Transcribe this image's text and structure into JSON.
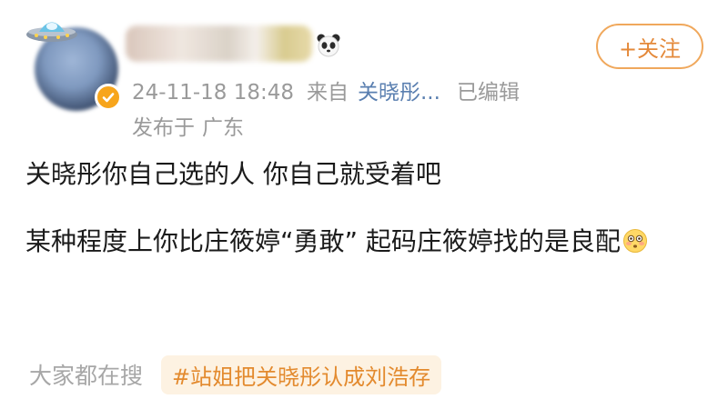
{
  "post": {
    "meta": {
      "timestamp": "24-11-18 18:48",
      "source_label": "来自",
      "source_name": "关晓彤...",
      "edited_label": "已编辑",
      "location_label": "发布于",
      "location": "广东"
    },
    "follow_label": "+关注",
    "body": {
      "line1": "关晓彤你自己选的人 你自己就受着吧",
      "line2": "某种程度上你比庄筱婷“勇敢” 起码庄筱婷找的是良配"
    }
  },
  "trending": {
    "label": "大家都在搜",
    "hashtag": "#站姐把关晓彤认成刘浩存"
  },
  "icons": {
    "ufo": "ufo-icon",
    "verified": "verified-badge-icon",
    "panda": "panda-icon",
    "emoji": "flushed-face-emoji-icon"
  },
  "colors": {
    "accent_orange": "#e4893a",
    "link_blue": "#5a7fb0",
    "meta_gray": "#9a9a9a",
    "chip_bg": "#fdf2e2"
  }
}
